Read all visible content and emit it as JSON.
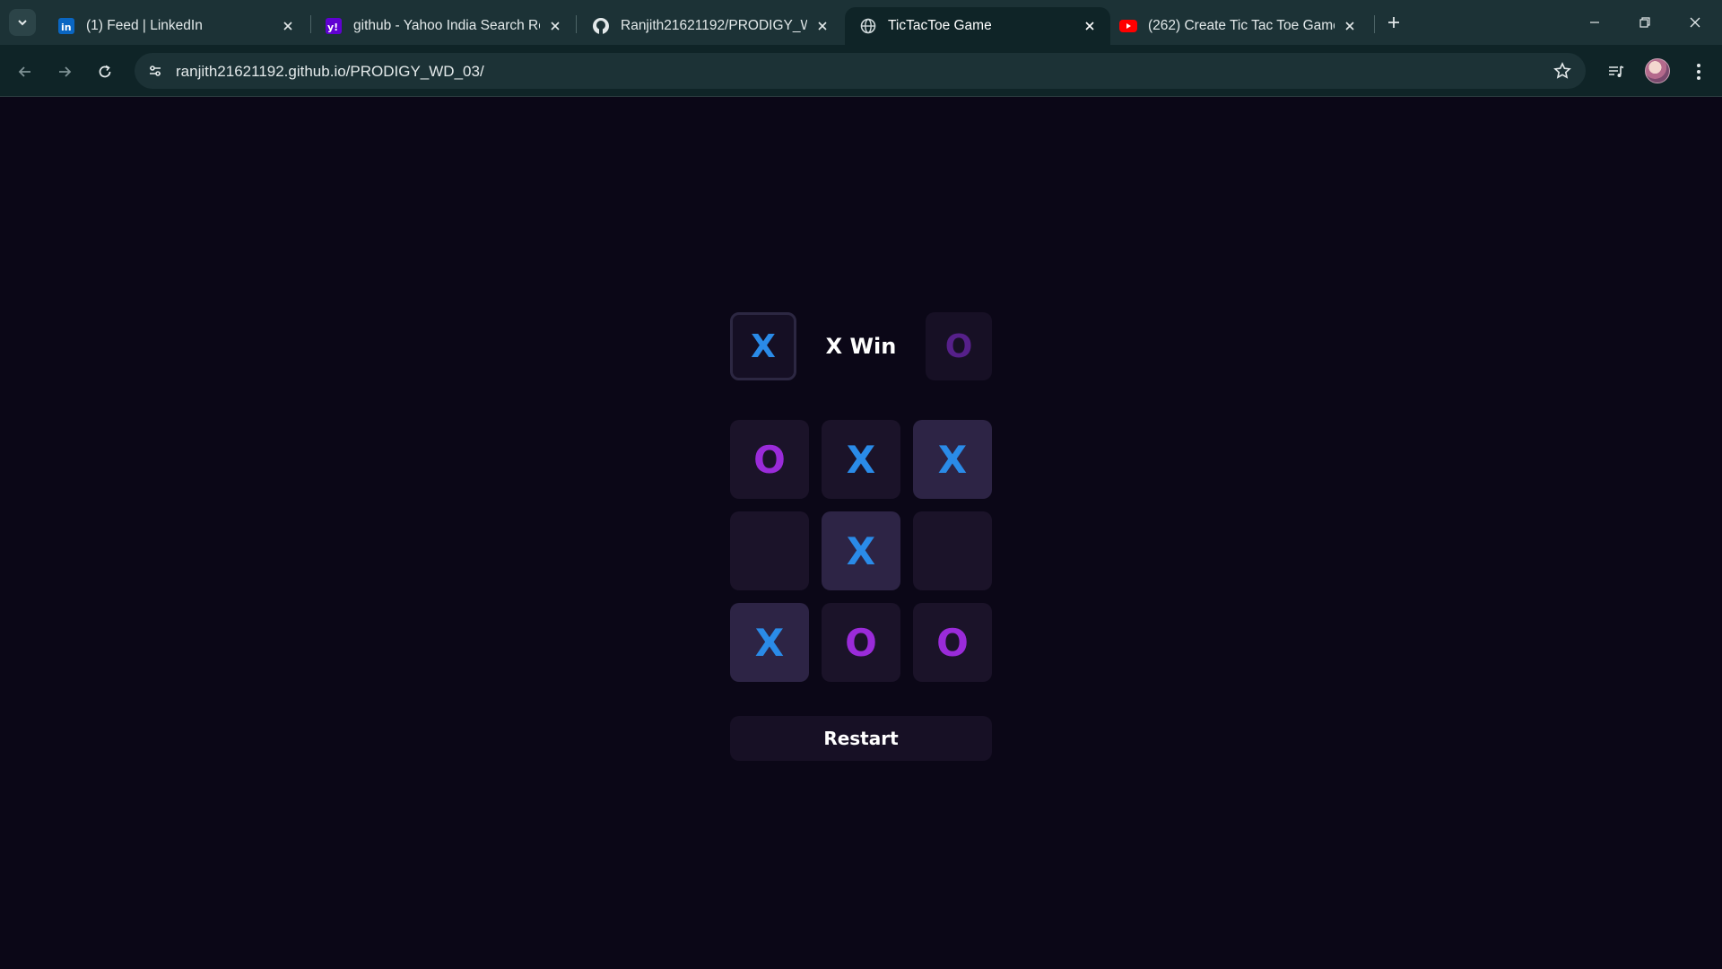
{
  "browser": {
    "tabs": [
      {
        "title": "(1) Feed | LinkedIn",
        "favicon": "linkedin-icon",
        "active": false
      },
      {
        "title": "github - Yahoo India Search Res",
        "favicon": "yahoo-icon",
        "active": false
      },
      {
        "title": "Ranjith21621192/PRODIGY_WD",
        "favicon": "github-icon",
        "active": false
      },
      {
        "title": "TicTacToe Game",
        "favicon": "globe-icon",
        "active": true
      },
      {
        "title": "(262) Create Tic Tac Toe Game |",
        "favicon": "youtube-icon",
        "active": false
      }
    ],
    "url": "ranjith21621192.github.io/PRODIGY_WD_03/"
  },
  "game": {
    "turn_x": "X",
    "turn_o": "O",
    "status": "X Win",
    "board": [
      {
        "mark": "O",
        "win": false
      },
      {
        "mark": "X",
        "win": false
      },
      {
        "mark": "X",
        "win": true
      },
      {
        "mark": "",
        "win": false
      },
      {
        "mark": "X",
        "win": true
      },
      {
        "mark": "",
        "win": false
      },
      {
        "mark": "X",
        "win": true
      },
      {
        "mark": "O",
        "win": false
      },
      {
        "mark": "O",
        "win": false
      }
    ],
    "restart_label": "Restart"
  },
  "colors": {
    "page_background": "#0b0717",
    "x_color": "#2a8be8",
    "o_color": "#9a2bd9",
    "cell_background": "#1b1329",
    "win_cell_background": "#2d2445"
  }
}
